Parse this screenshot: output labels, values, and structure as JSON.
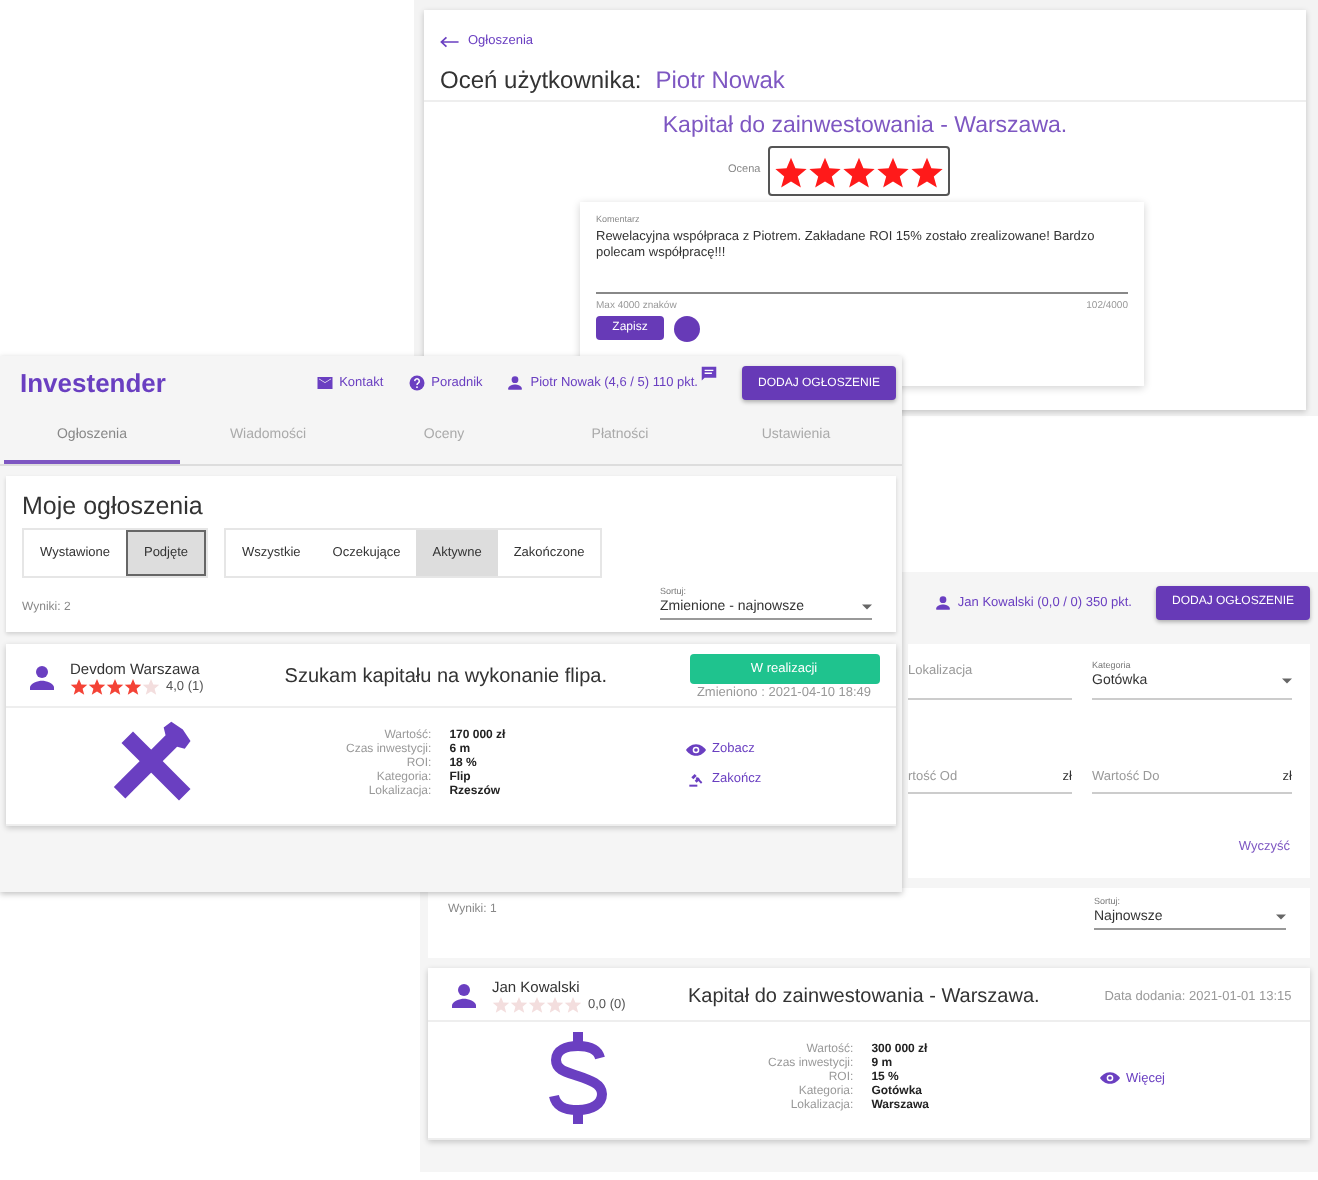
{
  "rating_window": {
    "back_link": "Ogłoszenia",
    "heading": "Oceń użytkownika:",
    "user": "Piotr Nowak",
    "listing_title": "Kapitał do zainwestowania - Warszawa.",
    "rating_label": "Ocena",
    "stars": 5,
    "comment": {
      "label": "Komentarz",
      "value": "Rewelacyjna współpraca z Piotrem. Zakładane ROI 15% zostało zrealizowane! Bardzo polecam współpracę!!!",
      "hint": "Max 4000 znaków",
      "counter": "102/4000"
    },
    "save_button": "Zapisz"
  },
  "my_listings_window": {
    "logo": "Investender",
    "nav": [
      {
        "label": "Kontakt",
        "kind": "mail"
      },
      {
        "label": "Poradnik",
        "kind": "help"
      },
      {
        "label": "Piotr Nowak (4,6 / 5) 110 pkt.",
        "kind": "user"
      }
    ],
    "add_button": "DODAJ OGŁOSZENIE",
    "tabs": [
      {
        "label": "Ogłoszenia",
        "selected": true
      },
      {
        "label": "Wiadomości",
        "selected": false
      },
      {
        "label": "Oceny",
        "selected": false
      },
      {
        "label": "Płatności",
        "selected": false
      },
      {
        "label": "Ustawienia",
        "selected": false
      }
    ],
    "heading": "Moje ogłoszenia",
    "role_filters": [
      {
        "label": "Wystawione",
        "selected": false
      },
      {
        "label": "Podjęte",
        "selected": true
      }
    ],
    "status_filters": [
      {
        "label": "Wszystkie",
        "selected": false
      },
      {
        "label": "Oczekujące",
        "selected": false
      },
      {
        "label": "Aktywne",
        "selected": true
      },
      {
        "label": "Zakończone",
        "selected": false
      }
    ],
    "results": "Wyniki: 2",
    "sort": {
      "label": "Sortuj:",
      "value": "Zmienione - najnowsze"
    },
    "listing": {
      "author": "Devdom Warszawa",
      "stars": 4,
      "rating": "4,0 (1)",
      "title": "Szukam kapitału na wykonanie flipa.",
      "status": "W realizacji",
      "date": "Zmieniono : 2021-04-10 18:49",
      "kind": "tools",
      "details": [
        {
          "label": "Wartość:",
          "value": "170 000 zł"
        },
        {
          "label": "Czas inwestycji:",
          "value": "6 m"
        },
        {
          "label": "ROI:",
          "value": "18 %"
        },
        {
          "label": "Kategoria:",
          "value": "Flip"
        },
        {
          "label": "Lokalizacja:",
          "value": "Rzeszów"
        }
      ],
      "actions": [
        {
          "label": "Zobacz",
          "kind": "view"
        },
        {
          "label": "Zakończ",
          "kind": "gavel"
        }
      ]
    }
  },
  "browse_window": {
    "user": "Jan Kowalski (0,0 / 0) 350 pkt.",
    "add_button": "DODAJ OGŁOSZENIE",
    "filters": [
      {
        "kind": "text",
        "placeholder": "Lokalizacja"
      },
      {
        "kind": "select",
        "label": "Kategoria",
        "value": "Gotówka"
      },
      {
        "kind": "text",
        "placeholder": "rtość Od",
        "suffix": "zł"
      },
      {
        "kind": "text",
        "placeholder": "Wartość Do",
        "suffix": "zł"
      }
    ],
    "clear_link": "Wyczyść",
    "results": "Wyniki: 1",
    "sort": {
      "label": "Sortuj:",
      "value": "Najnowsze"
    },
    "listing": {
      "author": "Jan Kowalski",
      "stars": 0,
      "rating": "0,0 (0)",
      "title": "Kapitał do zainwestowania - Warszawa.",
      "date": "Data dodania: 2021-01-01 13:15",
      "kind": "cash",
      "details": [
        {
          "label": "Wartość:",
          "value": "300 000 zł"
        },
        {
          "label": "Czas inwestycji:",
          "value": "9 m"
        },
        {
          "label": "ROI:",
          "value": "15 %"
        },
        {
          "label": "Kategoria:",
          "value": "Gotówka"
        },
        {
          "label": "Lokalizacja:",
          "value": "Warszawa"
        }
      ],
      "actions": [
        {
          "label": "Więcej",
          "kind": "view"
        }
      ]
    }
  }
}
